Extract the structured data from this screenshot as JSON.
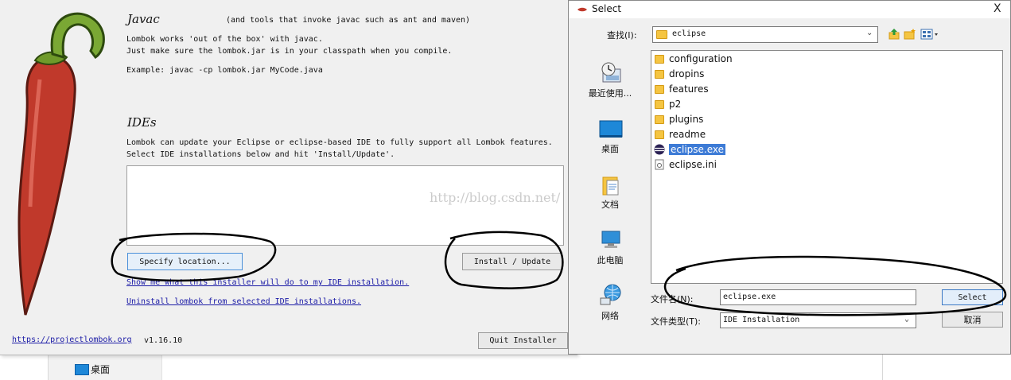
{
  "background": {
    "desktop_label": "桌面"
  },
  "installer": {
    "javac_heading": "Javac",
    "javac_note": "(and tools that invoke javac such as ant and maven)",
    "javac_line1": "Lombok works 'out of the box' with javac.",
    "javac_line2": "Just make sure the lombok.jar is in your classpath when you compile.",
    "javac_example": "Example: javac -cp lombok.jar MyCode.java",
    "ides_heading": "IDEs",
    "ides_line1": "Lombok can update your Eclipse or eclipse-based IDE to fully support all Lombok features.",
    "ides_line2": "Select IDE installations below and hit 'Install/Update'.",
    "specify_location_label": "Specify location...",
    "install_update_label": "Install / Update",
    "show_link": "Show me what this installer will do to my IDE installation.",
    "uninstall_link": "Uninstall lombok from selected IDE installations.",
    "website_link": "https://projectlombok.org",
    "version": "v1.16.10",
    "quit_label": "Quit Installer"
  },
  "watermark": "http://blog.csdn.net/",
  "dialog": {
    "title": "Select",
    "close_glyph": "X",
    "look_in_label": "查找(I):",
    "look_in_value": "eclipse",
    "places": [
      {
        "label": "最近使用..."
      },
      {
        "label": "桌面"
      },
      {
        "label": "文档"
      },
      {
        "label": "此电脑"
      },
      {
        "label": "网络"
      }
    ],
    "files": [
      {
        "name": "configuration",
        "kind": "folder"
      },
      {
        "name": "dropins",
        "kind": "folder"
      },
      {
        "name": "features",
        "kind": "folder"
      },
      {
        "name": "p2",
        "kind": "folder"
      },
      {
        "name": "plugins",
        "kind": "folder"
      },
      {
        "name": "readme",
        "kind": "folder"
      },
      {
        "name": "eclipse.exe",
        "kind": "exe",
        "selected": true
      },
      {
        "name": "eclipse.ini",
        "kind": "ini"
      }
    ],
    "filename_label": "文件名(N):",
    "filename_value": "eclipse.exe",
    "filetype_label": "文件类型(T):",
    "filetype_value": "IDE Installation",
    "select_label": "Select",
    "cancel_label": "取消"
  },
  "colors": {
    "selection": "#3d7bd6",
    "link": "#1a1aa6",
    "pepper": "#c0392b",
    "stem": "#6f9a2a"
  }
}
